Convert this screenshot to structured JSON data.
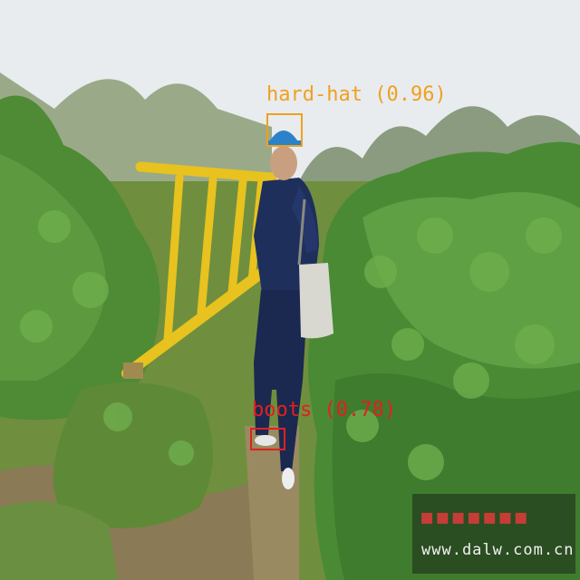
{
  "detections": [
    {
      "label": "hard-hat",
      "score": "0.96",
      "color": "#f0a020"
    },
    {
      "label": "boots",
      "score": "0.78",
      "color": "#e02020"
    }
  ],
  "watermark": {
    "url": "www.dalw.com.cn"
  }
}
